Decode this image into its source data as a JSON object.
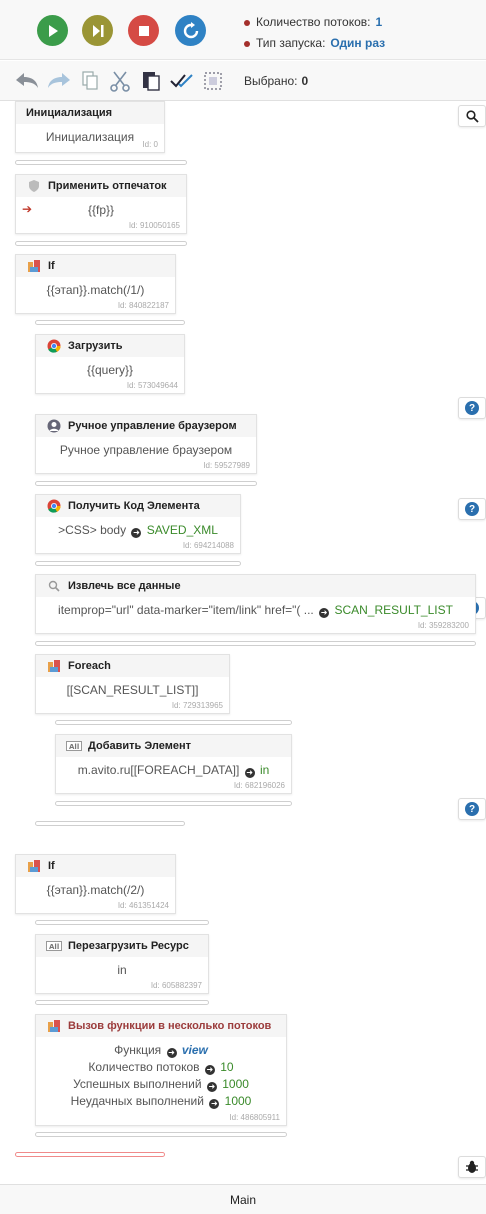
{
  "controls": {
    "play": {
      "icon": "play-icon",
      "color": "#3b9c4a"
    },
    "step": {
      "icon": "next-step-icon",
      "color": "#9a9535"
    },
    "stop": {
      "icon": "stop-icon",
      "color": "#d54a44"
    },
    "restart": {
      "icon": "restart-icon",
      "color": "#2f82c4"
    }
  },
  "info": {
    "threads_label": "Количество потоков:",
    "threads_value": "1",
    "launch_label": "Тип запуска:",
    "launch_value": "Один раз"
  },
  "toolbar": {
    "icons": [
      "undo-icon",
      "redo-icon",
      "copy-icon",
      "cut-icon",
      "paste-icon",
      "check-all-icon",
      "select-icon"
    ],
    "selected_label": "Выбрано:",
    "selected_value": "0"
  },
  "blocks": {
    "init": {
      "title": "Инициализация",
      "body": "Инициализация",
      "id": "Id: 0"
    },
    "fingerprint": {
      "title": "Применить отпечаток",
      "body": "{{fp}}",
      "id": "Id: 910050165"
    },
    "if1": {
      "title": "If",
      "body": "{{этап}}.match(/1/)",
      "id": "Id: 840822187"
    },
    "load": {
      "title": "Загрузить",
      "body": "{{query}}",
      "id": "Id: 573049644"
    },
    "manual": {
      "title": "Ручное управление браузером",
      "body": "Ручное управление браузером",
      "id": "Id: 59527989"
    },
    "getcode": {
      "title": "Получить Код Элемента",
      "body_a": ">CSS> body",
      "body_b": "SAVED_XML",
      "id": "Id: 694214088"
    },
    "extract": {
      "title": "Извлечь все данные",
      "body_a": "itemprop=\"url\" data-marker=\"item/link\" href=\"( ...",
      "body_b": "SCAN_RESULT_LIST",
      "id": "Id: 359283200"
    },
    "foreach": {
      "title": "Foreach",
      "body": "[[SCAN_RESULT_LIST]]",
      "id": "Id: 729313965"
    },
    "add": {
      "title": "Добавить Элемент",
      "body_a": "m.avito.ru[[FOREACH_DATA]]",
      "body_b": "in",
      "id": "Id: 682196026"
    },
    "if2": {
      "title": "If",
      "body": "{{этап}}.match(/2/)",
      "id": "Id: 461351424"
    },
    "reload": {
      "title": "Перезагрузить Ресурс",
      "body": "in",
      "id": "Id: 605882397"
    },
    "call": {
      "title": "Вызов функции в несколько потоков",
      "func_label": "Функция",
      "func_value": "view",
      "threads_label": "Количество потоков",
      "threads_value": "10",
      "success_label": "Успешных выполнений",
      "success_value": "1000",
      "fail_label": "Неудачных выполнений",
      "fail_value": "1000",
      "id": "Id: 486805911"
    }
  },
  "footer": {
    "tab": "Main"
  }
}
